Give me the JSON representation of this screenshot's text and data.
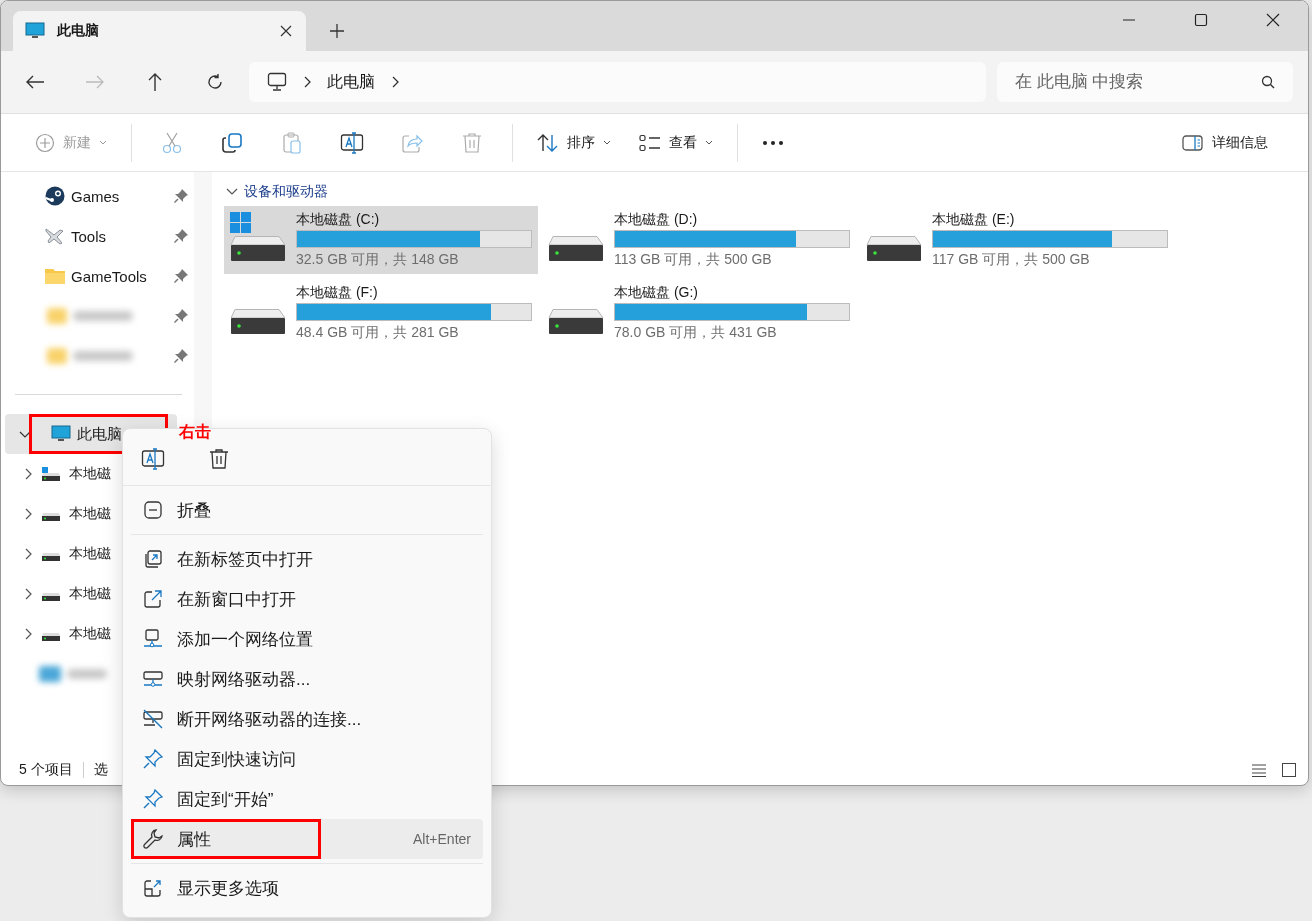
{
  "tabs": [
    {
      "label": "此电脑",
      "selected": true
    }
  ],
  "nav": {
    "back_disabled": false,
    "forward_disabled": true,
    "breadcrumb": [
      "此电脑"
    ],
    "search": {
      "placeholder": "在 此电脑 中搜索"
    }
  },
  "toolbar": {
    "new": {
      "label": "新建",
      "disabled": true
    },
    "tools": [
      {
        "kind": "cut",
        "disabled": true
      },
      {
        "kind": "copy",
        "disabled": false
      },
      {
        "kind": "paste",
        "disabled": true
      },
      {
        "kind": "rename",
        "disabled": false
      },
      {
        "kind": "share",
        "disabled": true
      },
      {
        "kind": "delete",
        "disabled": true
      }
    ],
    "sort": "排序",
    "view": "查看",
    "details": "详细信息"
  },
  "sidebar": {
    "pinned": [
      {
        "label": "Games",
        "kind": "steam"
      },
      {
        "label": "Tools",
        "kind": "plane"
      },
      {
        "label": "GameTools",
        "kind": "folder"
      },
      {
        "kind": "blurred"
      },
      {
        "kind": "blurred"
      }
    ],
    "this_pc": {
      "label": "此电脑",
      "expanded": true,
      "selected": true,
      "annotated": true,
      "children": [
        {
          "label": "本地磁",
          "system": true
        },
        {
          "label": "本地磁",
          "system": false
        },
        {
          "label": "本地磁",
          "system": false
        },
        {
          "label": "本地磁",
          "system": false
        },
        {
          "label": "本地磁",
          "system": false
        }
      ]
    }
  },
  "section": {
    "title": "设备和驱动器",
    "expanded": true
  },
  "drives": [
    {
      "name": "本地磁盘 (C:)",
      "level": 0.78,
      "reading": "32.5 GB 可用，共 148 GB",
      "system": true,
      "selected": true
    },
    {
      "name": "本地磁盘 (D:)",
      "level": 0.774,
      "reading": "113 GB 可用，共 500 GB",
      "system": false,
      "selected": false
    },
    {
      "name": "本地磁盘 (E:)",
      "level": 0.766,
      "reading": "117 GB 可用，共 500 GB",
      "system": false,
      "selected": false
    },
    {
      "name": "本地磁盘 (F:)",
      "level": 0.83,
      "reading": "48.4 GB 可用，共 281 GB",
      "system": false,
      "selected": false
    },
    {
      "name": "本地磁盘 (G:)",
      "level": 0.82,
      "reading": "78.0 GB 可用，共 431 GB",
      "system": false,
      "selected": false
    }
  ],
  "status_bar": {
    "count": "5 个项目",
    "selection": "选"
  },
  "annotation": {
    "label": "右击"
  },
  "context_menu": {
    "top_actions": [
      {
        "kind": "rename"
      },
      {
        "kind": "delete"
      }
    ],
    "groups": [
      [
        {
          "kind": "collapse",
          "label": "折叠",
          "selected": false
        }
      ],
      [
        {
          "kind": "new-tab",
          "label": "在新标签页中打开",
          "selected": false
        },
        {
          "kind": "new-window",
          "label": "在新窗口中打开",
          "selected": false
        },
        {
          "kind": "add-network",
          "label": "添加一个网络位置",
          "selected": false
        },
        {
          "kind": "map-drive",
          "label": "映射网络驱动器...",
          "selected": false
        },
        {
          "kind": "disconnect",
          "label": "断开网络驱动器的连接...",
          "selected": false
        },
        {
          "kind": "pin",
          "label": "固定到快速访问",
          "selected": false
        },
        {
          "kind": "pin",
          "label": "固定到“开始”",
          "selected": false
        },
        {
          "kind": "properties",
          "label": "属性",
          "shortcut": "Alt+Enter",
          "selected": true,
          "annotated": true
        }
      ],
      [
        {
          "kind": "more",
          "label": "显示更多选项",
          "selected": false
        }
      ]
    ]
  }
}
